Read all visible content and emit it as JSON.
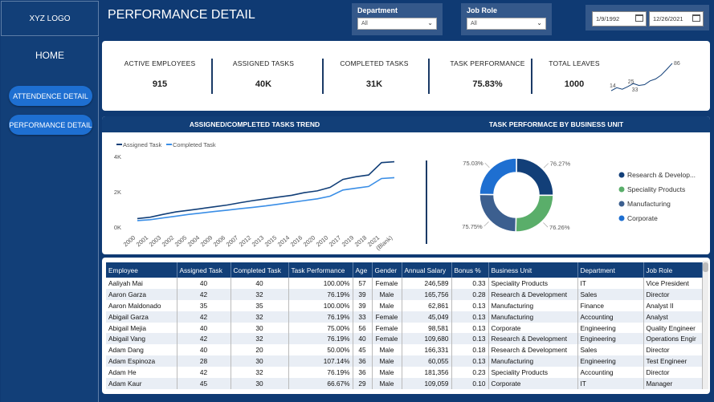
{
  "logo": "XYZ LOGO",
  "title": "PERFORMANCE DETAIL",
  "nav": {
    "home": "HOME",
    "items": [
      "ATTENDENCE DETAIL",
      "PERFORMANCE DETAIL"
    ]
  },
  "filters": {
    "department": {
      "label": "Department",
      "value": "All"
    },
    "job_role": {
      "label": "Job Role",
      "value": "All"
    },
    "date_from": "1/9/1992",
    "date_to": "12/26/2021"
  },
  "kpis": [
    {
      "label": "ACTIVE EMPLOYEES",
      "value": "915"
    },
    {
      "label": "ASSIGNED TASKS",
      "value": "40K"
    },
    {
      "label": "COMPLETED TASKS",
      "value": "31K"
    },
    {
      "label": "TASK PERFORMANCE",
      "value": "75.83%"
    },
    {
      "label": "TOTAL LEAVES",
      "value": "1000"
    }
  ],
  "sparkline": {
    "labels": [
      "14",
      "25",
      "33",
      "86"
    ],
    "values": [
      14,
      22,
      18,
      25,
      33,
      28,
      30,
      40,
      45,
      55,
      70,
      86
    ]
  },
  "colors": {
    "navy": "#123f78",
    "assigned": "#123f78",
    "completed": "#3a8ee6",
    "rd": "#123f78",
    "speciality": "#5aae6a",
    "manufacturing": "#3c5f8f",
    "corporate": "#1e6fd1"
  },
  "chart_data": [
    {
      "type": "line",
      "title": "ASSIGNED/COMPLETED TASKS TREND",
      "categories": [
        "2000",
        "2001",
        "2002",
        "2003",
        "2004",
        "2005",
        "2006",
        "2007",
        "2012",
        "2013",
        "2014",
        "2015",
        "2016",
        "2017",
        "2018",
        "2019",
        "2020",
        "2017b",
        "2018b",
        "2021",
        "(Blank)"
      ],
      "tick_labels": [
        "2000",
        "2001",
        "2003",
        "2002",
        "2005",
        "2004",
        "2009",
        "2006",
        "2007",
        "2012",
        "2013",
        "2015",
        "2014",
        "2016",
        "2020",
        "2010",
        "2017",
        "2019",
        "2018",
        "2021",
        "(Blank)"
      ],
      "series": [
        {
          "name": "Assigned Task",
          "values": [
            480,
            560,
            720,
            860,
            950,
            1050,
            1150,
            1250,
            1380,
            1500,
            1600,
            1700,
            1800,
            1950,
            2050,
            2250,
            2700,
            2850,
            2950,
            3650,
            3700
          ]
        },
        {
          "name": "Completed Task",
          "values": [
            370,
            420,
            520,
            620,
            720,
            800,
            880,
            960,
            1040,
            1120,
            1200,
            1300,
            1400,
            1500,
            1600,
            1750,
            2100,
            2200,
            2300,
            2750,
            2800
          ]
        }
      ],
      "y_ticks": [
        "0K",
        "2K",
        "4K"
      ],
      "ylim": [
        0,
        4000
      ]
    },
    {
      "type": "pie",
      "title": "TASK PERFORMACE BY BUSINESS UNIT",
      "labels": [
        "Research & Develop...",
        "Speciality Products",
        "Manufacturing",
        "Corporate"
      ],
      "values": [
        76.27,
        76.26,
        75.75,
        75.03
      ],
      "data_labels": [
        "76.27%",
        "76.26%",
        "75.75%",
        "75.03%"
      ]
    }
  ],
  "table": {
    "columns": [
      "Employee",
      "Assigned Task",
      "Completed Task",
      "Task Performance",
      "Age",
      "Gender",
      "Annual Salary",
      "Bonus %",
      "Business Unit",
      "Department",
      "Job Role"
    ],
    "rows": [
      [
        "Aaliyah Mai",
        "40",
        "40",
        "100.00%",
        "57",
        "Female",
        "246,589",
        "0.33",
        "Speciality Products",
        "IT",
        "Vice President"
      ],
      [
        "Aaron Garza",
        "42",
        "32",
        "76.19%",
        "39",
        "Male",
        "165,756",
        "0.28",
        "Research & Development",
        "Sales",
        "Director"
      ],
      [
        "Aaron Maldonado",
        "35",
        "35",
        "100.00%",
        "39",
        "Male",
        "62,861",
        "0.13",
        "Manufacturing",
        "Finance",
        "Analyst II"
      ],
      [
        "Abigail Garza",
        "42",
        "32",
        "76.19%",
        "33",
        "Female",
        "45,049",
        "0.13",
        "Manufacturing",
        "Accounting",
        "Analyst"
      ],
      [
        "Abigail Mejia",
        "40",
        "30",
        "75.00%",
        "56",
        "Female",
        "98,581",
        "0.13",
        "Corporate",
        "Engineering",
        "Quality Engineer"
      ],
      [
        "Abigail Vang",
        "42",
        "32",
        "76.19%",
        "40",
        "Female",
        "109,680",
        "0.13",
        "Research & Development",
        "Engineering",
        "Operations Engir"
      ],
      [
        "Adam Dang",
        "40",
        "20",
        "50.00%",
        "45",
        "Male",
        "166,331",
        "0.18",
        "Research & Development",
        "Sales",
        "Director"
      ],
      [
        "Adam Espinoza",
        "28",
        "30",
        "107.14%",
        "36",
        "Male",
        "60,055",
        "0.13",
        "Manufacturing",
        "Engineering",
        "Test Engineer"
      ],
      [
        "Adam He",
        "42",
        "32",
        "76.19%",
        "36",
        "Male",
        "181,356",
        "0.23",
        "Speciality Products",
        "Accounting",
        "Director"
      ],
      [
        "Adam Kaur",
        "45",
        "30",
        "66.67%",
        "29",
        "Male",
        "109,059",
        "0.10",
        "Corporate",
        "IT",
        "Manager"
      ]
    ]
  }
}
